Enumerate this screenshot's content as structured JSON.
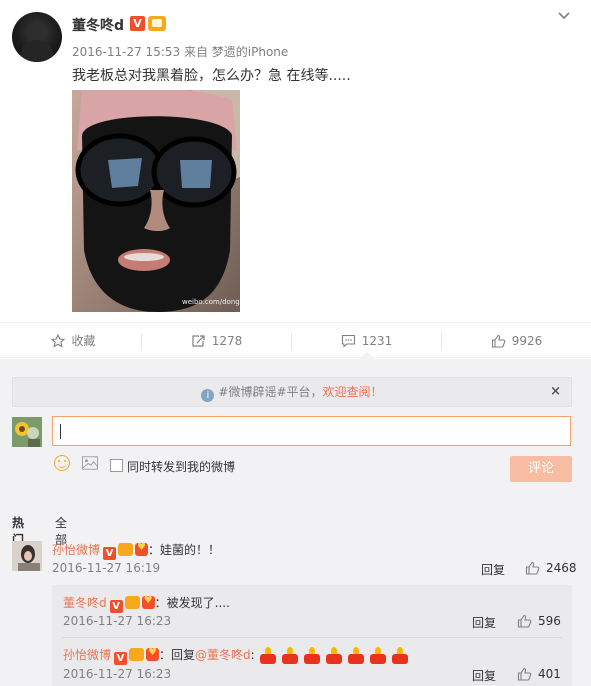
{
  "post": {
    "author": "董冬咚d",
    "badge_v": "V",
    "meta": "2016-11-27 15:53 来自 梦遗的iPhone",
    "text": "我老板总对我黑着脸，怎么办？急 在线等.....",
    "watermark": "weibo.com/dongdongdong"
  },
  "actions": {
    "favorite": "收藏",
    "repost_count": "1278",
    "comment_count": "1231",
    "like_count": "9926"
  },
  "comment_box": {
    "notice_prefix": "#微博辟谣#平台，",
    "notice_highlight": "欢迎查阅！",
    "notice_close": "×",
    "forward_label": "同时转发到我的微博",
    "submit_label": "评论"
  },
  "tabs": {
    "hot": "热门",
    "all": "全部"
  },
  "comments": [
    {
      "name": "孙怡微博",
      "text": "：娃菌的！！",
      "time": "2016-11-27 16:19",
      "reply": "回复",
      "likes": "2468"
    }
  ],
  "sub_comments": [
    {
      "name": "董冬咚d",
      "text": "：被发现了....",
      "time": "2016-11-27 16:23",
      "reply": "回复",
      "likes": "596"
    },
    {
      "name": "孙怡微博",
      "text_prefix": "：回复",
      "mention": "@董冬咚d",
      "text_suffix": ":",
      "candles": 7,
      "time": "2016-11-27 16:23",
      "reply": "回复",
      "likes": "401"
    }
  ],
  "icons": {
    "chevron": "chevron-down-icon",
    "star": "star-icon",
    "repost": "repost-icon",
    "comment": "comment-icon",
    "like": "thumb-up-icon"
  },
  "colors": {
    "accent": "#eb7350",
    "verified": "#f24e2b",
    "vip": "#f7a81d",
    "submit_disabled": "#f7bca1",
    "input_border": "#f7a26a"
  }
}
